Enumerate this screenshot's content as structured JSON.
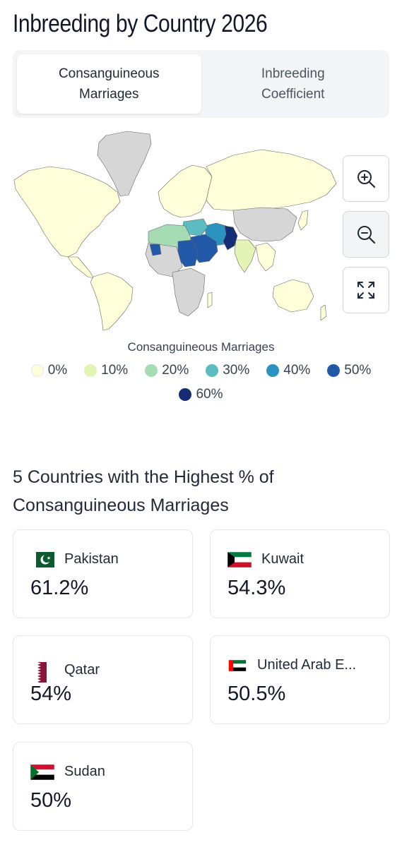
{
  "title": "Inbreeding by Country 2026",
  "tabs": [
    {
      "label": "Consanguineous Marriages",
      "active": true
    },
    {
      "label": "Inbreeding Coefficient",
      "active": false
    }
  ],
  "map_controls": {
    "zoom_in": "zoom-in-icon",
    "zoom_out": "zoom-out-icon",
    "fullscreen": "expand-icon"
  },
  "legend": {
    "title": "Consanguineous Marriages",
    "items": [
      {
        "label": "0%",
        "color": "#ffffd9"
      },
      {
        "label": "10%",
        "color": "#e4f4b4"
      },
      {
        "label": "20%",
        "color": "#a6dcb4"
      },
      {
        "label": "30%",
        "color": "#5bbcc1"
      },
      {
        "label": "40%",
        "color": "#2a93c0"
      },
      {
        "label": "50%",
        "color": "#2258a8"
      },
      {
        "label": "60%",
        "color": "#162c74"
      }
    ]
  },
  "map_colors": {
    "no_data": "#d6d6d6",
    "border": "#666666"
  },
  "top5": {
    "title": "5 Countries with the Highest % of Consanguineous Marriages",
    "countries": [
      {
        "name": "Pakistan",
        "value": "61.2%"
      },
      {
        "name": "Kuwait",
        "value": "54.3%"
      },
      {
        "name": "Qatar",
        "value": "54%"
      },
      {
        "name": "United Arab E...",
        "value": "50.5%"
      },
      {
        "name": "Sudan",
        "value": "50%"
      }
    ]
  }
}
